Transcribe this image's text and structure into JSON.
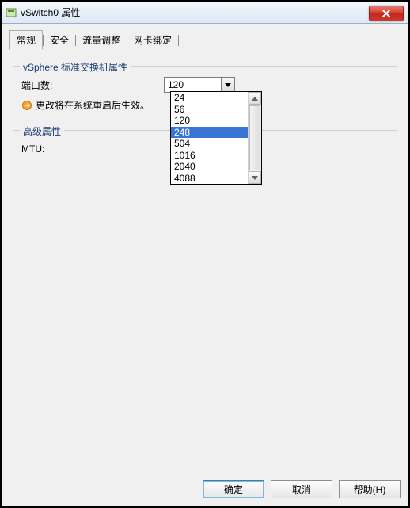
{
  "window": {
    "title": "vSwitch0 属性"
  },
  "tabs": {
    "t0": "常规",
    "t1": "安全",
    "t2": "流量调整",
    "t3": "网卡绑定"
  },
  "group1": {
    "title": "vSphere 标准交换机属性",
    "port_label": "端口数:",
    "port_value": "120",
    "note": "更改将在系统重启后生效。"
  },
  "group2": {
    "title": "高级属性",
    "mtu_label": "MTU:"
  },
  "dropdown": {
    "items": [
      "24",
      "56",
      "120",
      "248",
      "504",
      "1016",
      "2040",
      "4088"
    ],
    "selected_index": 3
  },
  "buttons": {
    "ok": "确定",
    "cancel": "取消",
    "help": "帮助(H)"
  }
}
